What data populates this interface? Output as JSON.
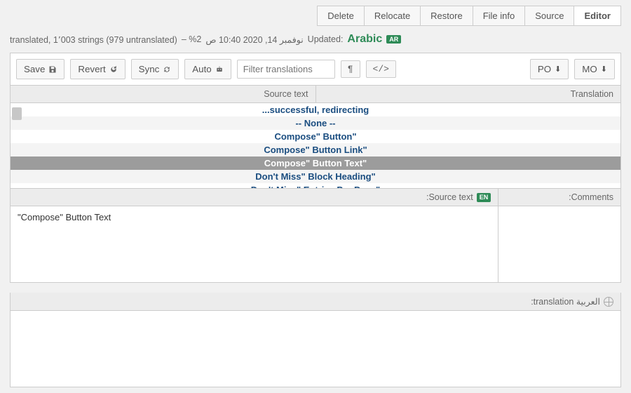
{
  "tabs": {
    "delete": "Delete",
    "relocate": "Relocate",
    "restore": "Restore",
    "fileinfo": "File info",
    "source": "Source",
    "editor": "Editor"
  },
  "meta": {
    "badge": "AR",
    "lang": "Arabic",
    "updated_label": ":Updated",
    "timestamp": "نوفمبر 14, 2020 10:40 ص",
    "percent": "%2 – ",
    "stats": "translated, 1٬003 strings (979 untranslated)"
  },
  "toolbar": {
    "save": "Save",
    "revert": "Revert",
    "sync": "Sync",
    "auto": "Auto",
    "filter_placeholder": "Filter translations",
    "po": "PO",
    "mo": "MO"
  },
  "columns": {
    "source": "Source text",
    "translation": "Translation"
  },
  "rows": [
    "...successful, redirecting",
    "-- None --",
    "Compose\" Button\"",
    "Compose\" Button Link\"",
    "Compose\" Button Text\"",
    "Don't Miss\" Block Heading\"",
    "Don't Miss\" Entries Per Page\""
  ],
  "selected_index": 4,
  "panes": {
    "source_label": ":Source text",
    "source_badge": "EN",
    "source_value": "\"Compose\" Button Text",
    "comments_label": ":Comments",
    "translation_label": ":translation العربية"
  }
}
